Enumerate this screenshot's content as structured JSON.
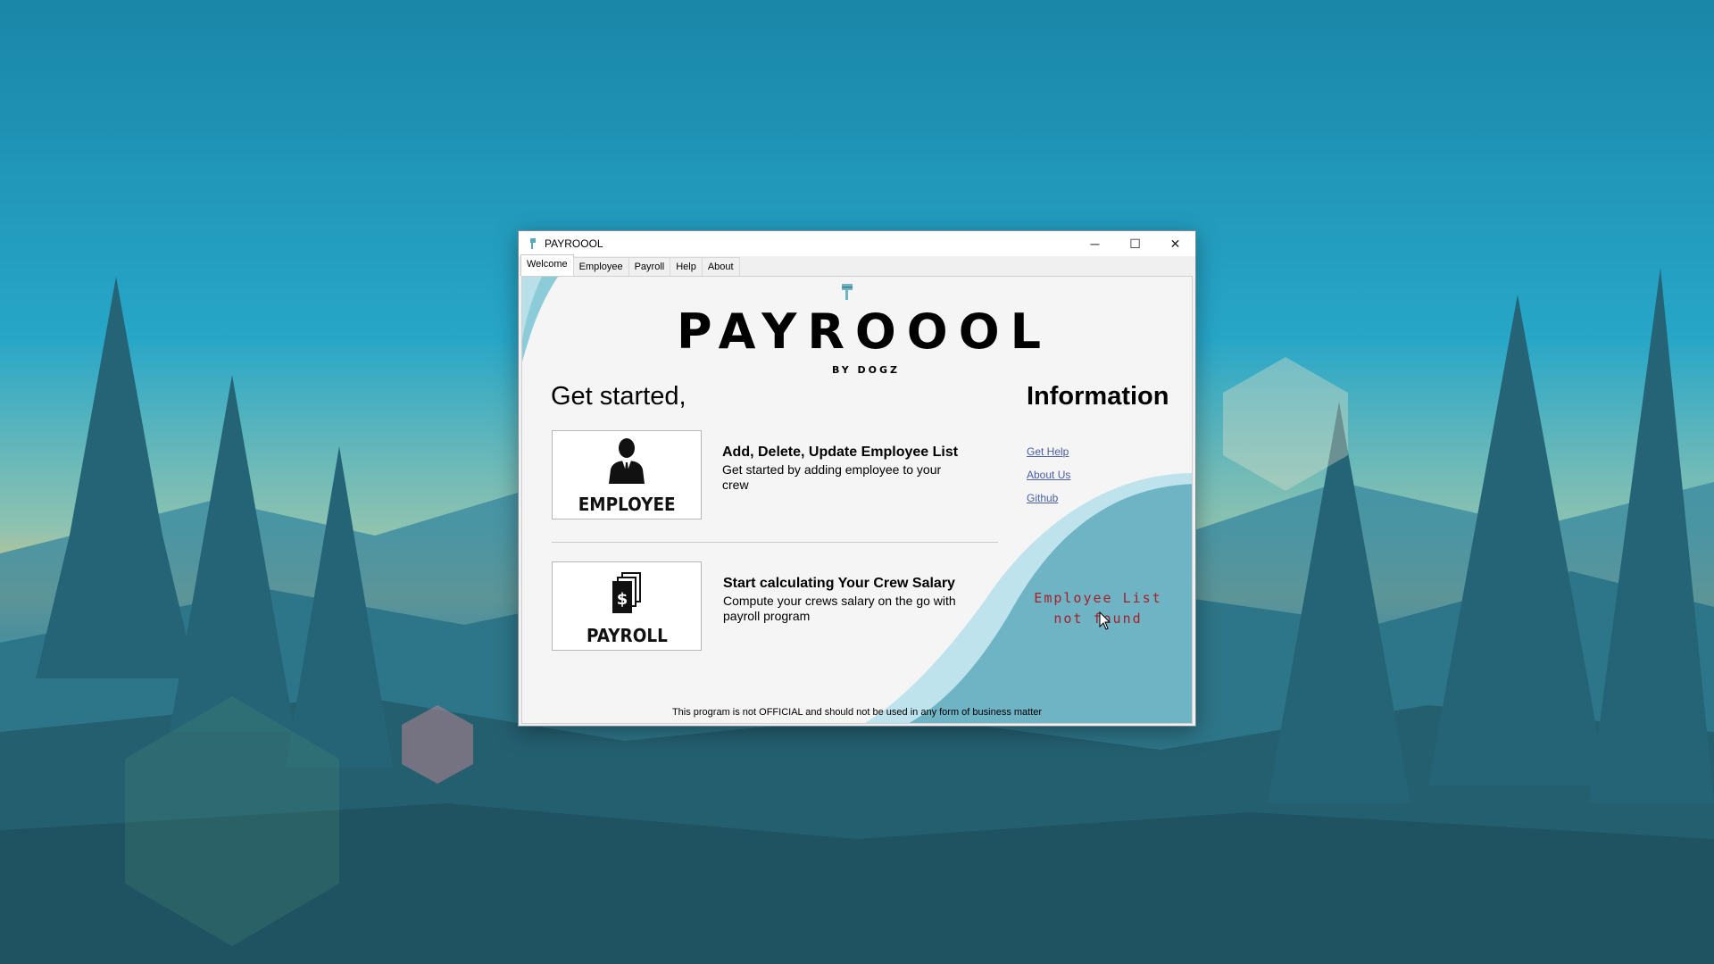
{
  "window": {
    "title": "PAYROOOL",
    "controls": {
      "minimize": "─",
      "maximize": "☐",
      "close": "✕"
    }
  },
  "tabs": [
    "Welcome",
    "Employee",
    "Payroll",
    "Help",
    "About"
  ],
  "logo": {
    "title": "PAYROOOL",
    "subtitle": "BY DOGZ"
  },
  "welcome": {
    "heading": "Get started,",
    "cards": [
      {
        "button_label": "EMPLOYEE",
        "icon": "employee-icon",
        "title": "Add, Delete, Update Employee List",
        "description": "Get started by adding employee to your crew"
      },
      {
        "button_label": "PAYROLL",
        "icon": "payroll-document-icon",
        "title": "Start calculating Your Crew Salary",
        "description": "Compute your crews salary on the go with payroll program"
      }
    ]
  },
  "information": {
    "heading": "Information",
    "links": [
      "Get Help",
      "About Us",
      "Github"
    ],
    "status_message": "Employee List not found"
  },
  "disclaimer": "This program is not OFFICIAL and should not be used in any form of business matter",
  "colors": {
    "accent_teal": "#6fb4c4",
    "status_red": "#a61f2a",
    "link_blue": "#4a5fa8"
  }
}
